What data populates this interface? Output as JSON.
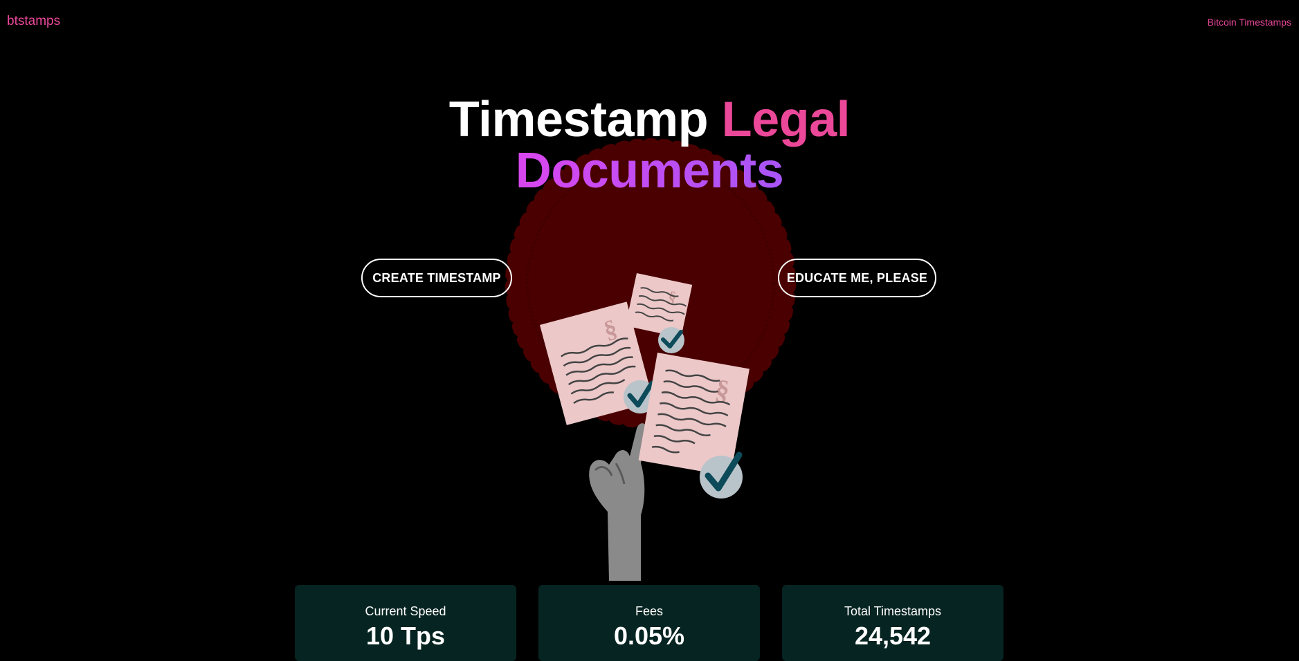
{
  "nav": {
    "brand": "btstamps",
    "link": "Bitcoin Timestamps"
  },
  "hero": {
    "title_word_1": "Timestamp",
    "title_word_2": "Legal",
    "title_word_3": "Documents",
    "primary_cta": "CREATE TIMESTAMP",
    "secondary_cta": "EDUCATE ME, PLEASE"
  },
  "illustration": {
    "document_symbol": "§",
    "icons": [
      "wax-seal-icon",
      "document-icon",
      "checkmark-icon",
      "hand-icon"
    ]
  },
  "stats": [
    {
      "label": "Current Speed",
      "value": "10 Tps"
    },
    {
      "label": "Fees",
      "value": "0.05%"
    },
    {
      "label": "Total Timestamps",
      "value": "24,542"
    }
  ],
  "colors": {
    "background": "#000000",
    "accent_pink": "#ec4899",
    "accent_purple": "#a855f7",
    "card_background": "#062421",
    "seal": "#4a0000",
    "check": "#0d4a5a"
  }
}
